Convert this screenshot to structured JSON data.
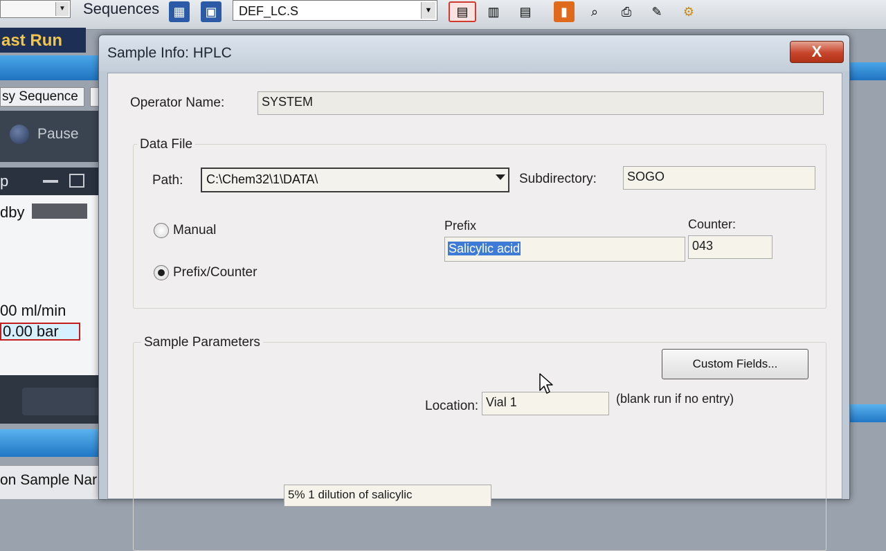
{
  "app": {
    "toolbar": {
      "sequences_label": "Sequences",
      "method_name": "DEF_LC.S"
    },
    "last_run_label": "ast Run",
    "easy_sequence_tab": "sy Sequence",
    "pause_label": "Pause",
    "side_panel": {
      "header": "p",
      "standby_label": "dby",
      "flow_text": "00 ml/min",
      "pressure_text": "0.00 bar"
    },
    "sample_name_tab": "on  Sample Nar"
  },
  "dialog": {
    "title": "Sample Info: HPLC",
    "close_label": "X",
    "operator_name_label": "Operator Name:",
    "operator_name_value": "SYSTEM",
    "data_file": {
      "group_title": "Data File",
      "path_label": "Path:",
      "path_value": "C:\\Chem32\\1\\DATA\\",
      "subdirectory_label": "Subdirectory:",
      "subdirectory_value": "SOGO",
      "manual_label": "Manual",
      "prefix_counter_label": "Prefix/Counter",
      "selected_mode": "Prefix/Counter",
      "prefix_label": "Prefix",
      "prefix_value": "Salicylic acid",
      "counter_label": "Counter:",
      "counter_value": "043"
    },
    "sample_parameters": {
      "group_title": "Sample Parameters",
      "custom_fields_label": "Custom Fields...",
      "location_label": "Location:",
      "location_value": "Vial 1",
      "location_hint": "(blank run if no entry)",
      "sample_name_partial": "5% 1 dilution of salicylic"
    }
  }
}
